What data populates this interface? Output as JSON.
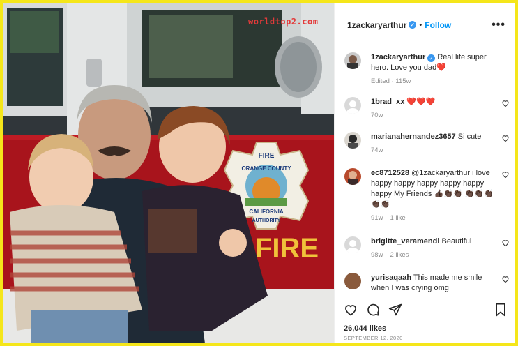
{
  "watermark": "worldtop2.com",
  "post": {
    "username": "1zackaryarthur",
    "follow_label": "Follow",
    "separator": "•",
    "more_label": "•••"
  },
  "caption": {
    "username": "1zackaryarthur",
    "text": "Real life super hero. Love you dad",
    "emoji": "❤️",
    "meta": "Edited · 115w"
  },
  "comments": [
    {
      "username": "1brad_xx",
      "text": "❤️❤️❤️",
      "age": "70w",
      "likes": ""
    },
    {
      "username": "marianahernandez3657",
      "text": "Si cute",
      "age": "74w",
      "likes": ""
    },
    {
      "username": "ec8712528",
      "text": "@1zackaryarthur i love happy happy happy happy happy happy My Friends 👍🏿👏🏿👏🏿 👏🏿👏🏿👏🏿👏🏿👏🏿",
      "age": "91w",
      "likes": "1 like"
    },
    {
      "username": "brigitte_veramendi",
      "text": "Beautiful",
      "age": "98w",
      "likes": "2 likes"
    },
    {
      "username": "yurisaqaah",
      "text": "This made me smile when I was crying omg",
      "age": "",
      "likes": ""
    }
  ],
  "footer": {
    "likes": "26,044 likes",
    "date": "SEPTEMBER 12, 2020"
  },
  "photo": {
    "truck_text": "FIRE",
    "badge_top": "FIRE",
    "badge_mid": "ORANGE COUNTY",
    "badge_low": "CALIFORNIA",
    "badge_bottom": "AUTHORITY"
  },
  "colors": {
    "frame": "#f5e61a",
    "truck_red": "#a8141c",
    "link": "#0095f6",
    "heart": "#ed4956"
  }
}
